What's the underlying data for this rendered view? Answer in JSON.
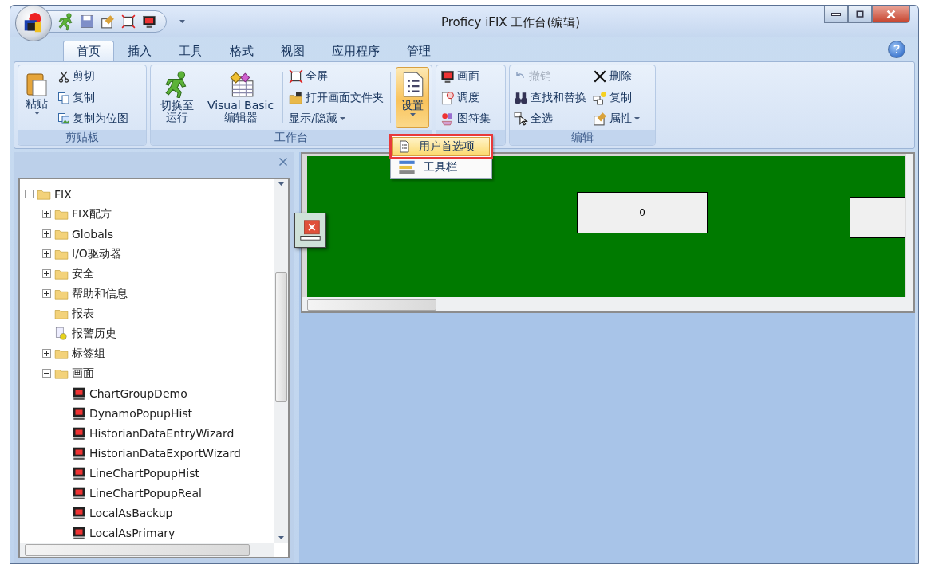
{
  "window": {
    "title": "Proficy iFIX 工作台(编辑)"
  },
  "tabs": [
    {
      "label": "首页",
      "selected": true
    },
    {
      "label": "插入",
      "selected": false
    },
    {
      "label": "工具",
      "selected": false
    },
    {
      "label": "格式",
      "selected": false
    },
    {
      "label": "视图",
      "selected": false
    },
    {
      "label": "应用程序",
      "selected": false
    },
    {
      "label": "管理",
      "selected": false
    }
  ],
  "ribbon_groups": [
    {
      "label": "剪贴板",
      "items": [
        {
          "kind": "large",
          "label": "粘贴",
          "dropdown": true,
          "pressed": false
        },
        {
          "kind": "column",
          "items": [
            {
              "label": "剪切",
              "disabled": false
            },
            {
              "label": "复制",
              "disabled": false
            },
            {
              "label": "复制为位图",
              "disabled": false
            }
          ]
        }
      ]
    },
    {
      "label": "工作台",
      "items": [
        {
          "kind": "large",
          "label": "切换至运行",
          "pressed": false
        },
        {
          "kind": "large",
          "label": "Visual Basic 编辑器",
          "pressed": false
        },
        {
          "kind": "column",
          "items": [
            {
              "label": "全屏",
              "disabled": false
            },
            {
              "label": "打开画面文件夹",
              "disabled": false
            },
            {
              "label": "显示/隐藏",
              "disabled": false,
              "dropdown": true
            }
          ]
        },
        {
          "kind": "large",
          "label": "设置",
          "dropdown": true,
          "pressed": true
        }
      ]
    },
    {
      "items": [
        {
          "kind": "column",
          "items": [
            {
              "label": "画面",
              "disabled": false
            },
            {
              "label": "调度",
              "disabled": false
            },
            {
              "label": "图符集",
              "disabled": false
            }
          ]
        }
      ]
    },
    {
      "label": "编辑",
      "items": [
        {
          "kind": "column",
          "items": [
            {
              "label": "撤销",
              "disabled": true
            },
            {
              "label": "查找和替换",
              "disabled": false
            },
            {
              "label": "全选",
              "disabled": false
            }
          ]
        },
        {
          "kind": "column",
          "items": [
            {
              "label": "删除",
              "disabled": false
            },
            {
              "label": "复制",
              "disabled": false
            },
            {
              "label": "属性",
              "disabled": false,
              "dropdown": true
            }
          ]
        }
      ]
    }
  ],
  "settings_menu": [
    {
      "label": "用户首选项",
      "selected": true
    },
    {
      "label": "工具栏",
      "selected": false
    }
  ],
  "tree": [
    {
      "kind": "folder",
      "label": "FIX",
      "expanded": true,
      "children": [
        {
          "kind": "folder",
          "label": "FIX配方",
          "expanded": false
        },
        {
          "kind": "folder",
          "label": "Globals",
          "expanded": false
        },
        {
          "kind": "folder",
          "label": "I/O驱动器",
          "expanded": false
        },
        {
          "kind": "folder",
          "label": "安全",
          "expanded": false
        },
        {
          "kind": "folder",
          "label": "帮助和信息",
          "expanded": false
        },
        {
          "kind": "folder",
          "label": "报表"
        },
        {
          "kind": "alarm",
          "label": "报警历史"
        },
        {
          "kind": "folder",
          "label": "标签组",
          "expanded": false
        },
        {
          "kind": "folder",
          "label": "画面",
          "expanded": true,
          "children": [
            {
              "kind": "picture",
              "label": "ChartGroupDemo"
            },
            {
              "kind": "picture",
              "label": "DynamoPopupHist"
            },
            {
              "kind": "picture",
              "label": "HistorianDataEntryWizard"
            },
            {
              "kind": "picture",
              "label": "HistorianDataExportWizard"
            },
            {
              "kind": "picture",
              "label": "LineChartPopupHist"
            },
            {
              "kind": "picture",
              "label": "LineChartPopupReal"
            },
            {
              "kind": "picture",
              "label": "LocalAsBackup"
            },
            {
              "kind": "picture",
              "label": "LocalAsPrimary"
            }
          ]
        }
      ]
    }
  ],
  "canvas": {
    "fields": [
      {
        "value": "0"
      }
    ]
  }
}
